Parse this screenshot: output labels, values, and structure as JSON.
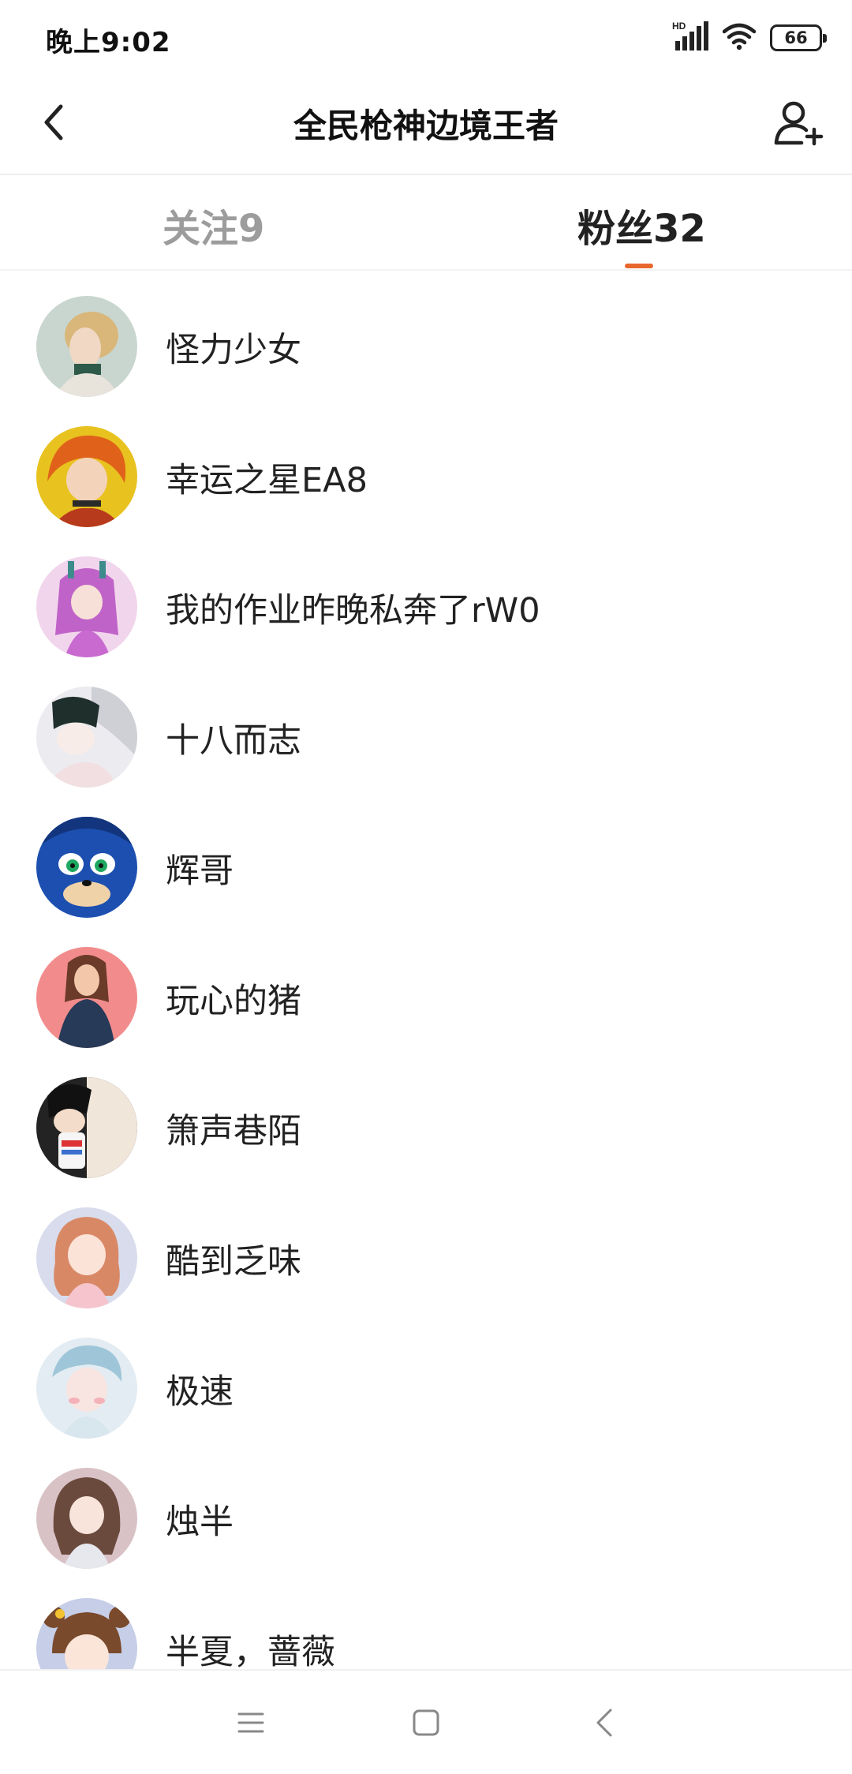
{
  "status_bar": {
    "time": "晚上9:02",
    "network_label": "HD",
    "battery": "66",
    "icons": [
      "signal-icon",
      "wifi-icon",
      "battery-icon"
    ]
  },
  "header": {
    "title": "全民枪神边境王者",
    "back_icon": "chevron-left-icon",
    "add_user_icon": "add-user-icon"
  },
  "tabs": {
    "following_label": "关注9",
    "fans_label": "粉丝32",
    "active": "fans",
    "accent_color": "#e8662c"
  },
  "fans": [
    {
      "name": "怪力少女"
    },
    {
      "name": "幸运之星EA8"
    },
    {
      "name": "我的作业昨晚私奔了rW0"
    },
    {
      "name": "十八而志"
    },
    {
      "name": "辉哥"
    },
    {
      "name": "玩心的猪"
    },
    {
      "name": "箫声巷陌"
    },
    {
      "name": "酷到乏味"
    },
    {
      "name": "极速"
    },
    {
      "name": "烛半"
    },
    {
      "name": "半夏，蔷薇"
    }
  ],
  "nav_bar": {
    "icons": [
      "menu-icon",
      "home-square-icon",
      "back-triangle-icon"
    ]
  }
}
